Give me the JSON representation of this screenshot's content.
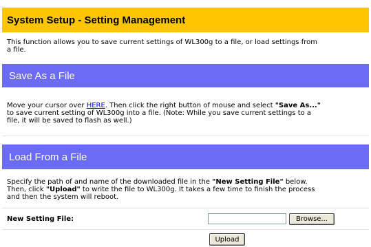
{
  "header": {
    "title": "System Setup - Setting Management"
  },
  "intro": {
    "line1": "This function allows you to save current settings of WL300g to a file, or load settings from",
    "line2": "a file."
  },
  "save_section": {
    "title": "Save As a File",
    "line1_prefix": "Move your cursor over ",
    "link_text": "HERE",
    "line1_mid": ". Then click the right button of mouse and select ",
    "line1_bold": "\"Save As...\"",
    "line2": "to save current setting of WL300g into a file. (Note: While you save current settings to a",
    "line3": "file, it will be saved to flash as well.)"
  },
  "load_section": {
    "title": "Load From a File",
    "line1_prefix": "Specify the path of and name of the downloaded file in the ",
    "line1_bold": "\"New Setting File\"",
    "line1_suffix": " below.",
    "line2_prefix": "Then, click ",
    "line2_bold": "\"Upload\"",
    "line2_suffix": " to write the file to WL300g. It takes a few time to finish the process",
    "line3": "and then the system will reboot."
  },
  "form": {
    "label": "New Setting File:",
    "file_value": "",
    "browse_label": "Browse...",
    "upload_label": "Upload"
  }
}
